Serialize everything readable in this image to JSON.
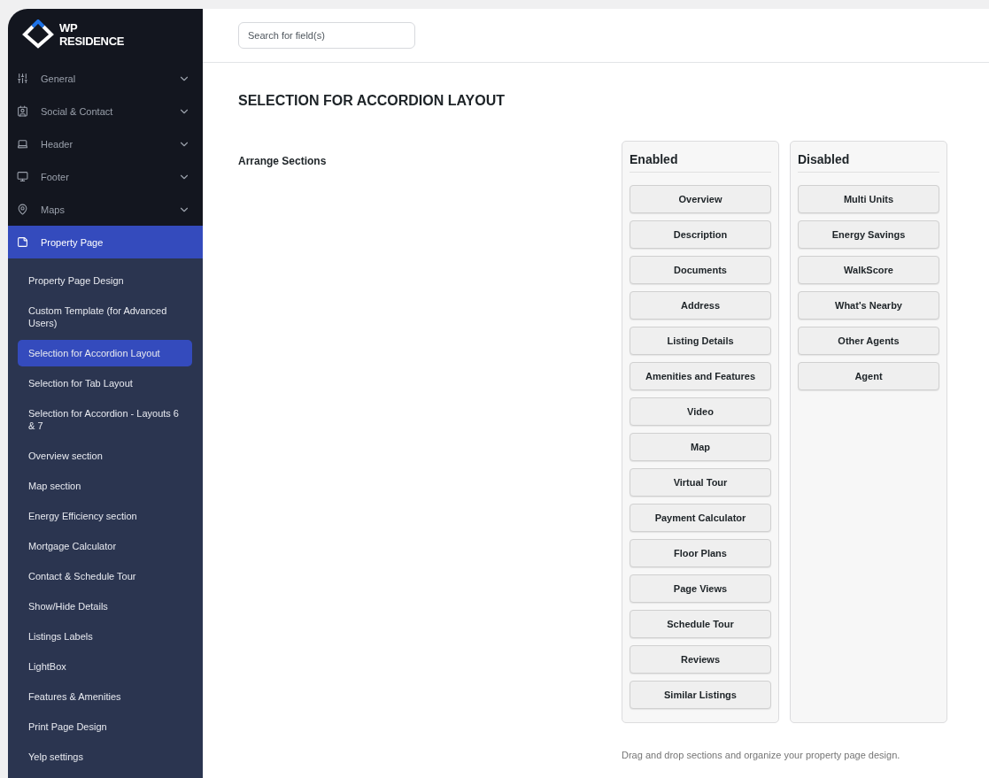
{
  "logo": {
    "line_1": "WP",
    "line_2": "RESIDENCE"
  },
  "sidebar": {
    "items": [
      {
        "label": "General",
        "expanded": false,
        "selected": false
      },
      {
        "label": "Social & Contact",
        "expanded": false,
        "selected": false
      },
      {
        "label": "Header",
        "expanded": false,
        "selected": false
      },
      {
        "label": "Footer",
        "expanded": false,
        "selected": false
      },
      {
        "label": "Maps",
        "expanded": false,
        "selected": false
      },
      {
        "label": "Property Page",
        "expanded": true,
        "selected": true,
        "children": [
          {
            "label": "Property Page Design",
            "selected": false
          },
          {
            "label": "Custom Template (for Advanced Users)",
            "selected": false
          },
          {
            "label": "Selection for Accordion Layout",
            "selected": true
          },
          {
            "label": "Selection for Tab Layout",
            "selected": false
          },
          {
            "label": "Selection for Accordion - Layouts 6 & 7",
            "selected": false
          },
          {
            "label": "Overview section",
            "selected": false
          },
          {
            "label": "Map section",
            "selected": false
          },
          {
            "label": "Energy Efficiency section",
            "selected": false
          },
          {
            "label": "Mortgage Calculator",
            "selected": false
          },
          {
            "label": "Contact & Schedule Tour",
            "selected": false
          },
          {
            "label": "Show/Hide Details",
            "selected": false
          },
          {
            "label": "Listings Labels",
            "selected": false
          },
          {
            "label": "LightBox",
            "selected": false
          },
          {
            "label": "Features & Amenities",
            "selected": false
          },
          {
            "label": "Print Page Design",
            "selected": false
          },
          {
            "label": "Yelp settings",
            "selected": false
          }
        ]
      }
    ]
  },
  "search": {
    "placeholder": "Search for field(s)"
  },
  "page_title": "SELECTION FOR ACCORDION LAYOUT",
  "field_label": "Arrange Sections",
  "columns": [
    {
      "title": "Enabled",
      "items": [
        "Overview",
        "Description",
        "Documents",
        "Address",
        "Listing Details",
        "Amenities and Features",
        "Video",
        "Map",
        "Virtual Tour",
        "Payment Calculator",
        "Floor Plans",
        "Page Views",
        "Schedule Tour",
        "Reviews",
        "Similar Listings"
      ]
    },
    {
      "title": "Disabled",
      "items": [
        "Multi Units",
        "Energy Savings",
        "WalkScore",
        "What's Nearby",
        "Other Agents",
        "Agent"
      ]
    }
  ],
  "hint": "Drag and drop sections and organize your property page design."
}
